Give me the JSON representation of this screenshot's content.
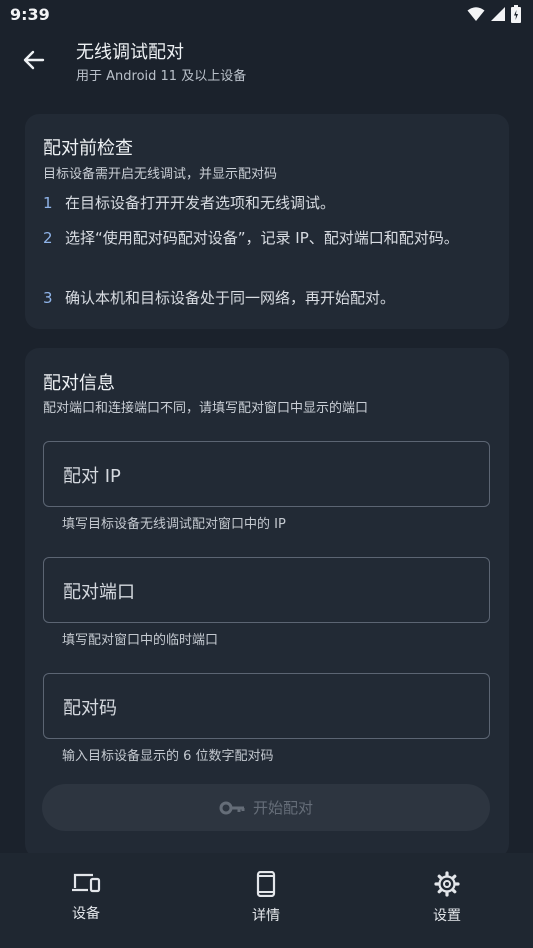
{
  "status_bar": {
    "time": "9:39"
  },
  "app_bar": {
    "title": "无线调试配对",
    "subtitle": "用于 Android 11 及以上设备"
  },
  "check_card": {
    "title": "配对前检查",
    "subtitle": "目标设备需开启无线调试，并显示配对码",
    "steps": [
      {
        "num": "1",
        "text": "在目标设备打开开发者选项和无线调试。"
      },
      {
        "num": "2",
        "text": "选择“使用配对码配对设备”，记录 IP、配对端口和配对码。"
      },
      {
        "num": "3",
        "text": "确认本机和目标设备处于同一网络，再开始配对。"
      }
    ]
  },
  "info_card": {
    "title": "配对信息",
    "subtitle": "配对端口和连接端口不同，请填写配对窗口中显示的端口",
    "fields": [
      {
        "label": "配对 IP",
        "help": "填写目标设备无线调试配对窗口中的 IP"
      },
      {
        "label": "配对端口",
        "help": "填写配对窗口中的临时端口"
      },
      {
        "label": "配对码",
        "help": "输入目标设备显示的 6 位数字配对码"
      }
    ],
    "start_button": "开始配对"
  },
  "bottom_nav": [
    {
      "label": "设备",
      "icon": "devices-icon"
    },
    {
      "label": "详情",
      "icon": "phone-icon"
    },
    {
      "label": "设置",
      "icon": "gear-icon"
    }
  ]
}
